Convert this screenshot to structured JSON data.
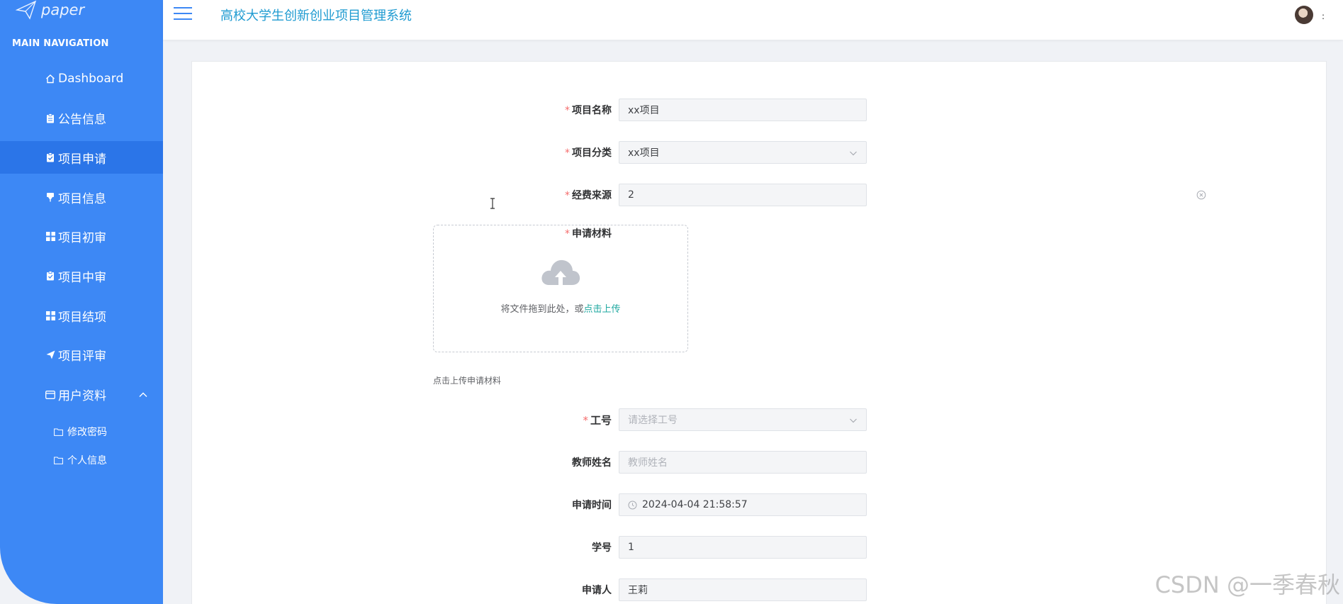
{
  "brand": {
    "name": "paper"
  },
  "sidebar": {
    "section_title": "MAIN NAVIGATION",
    "items": [
      {
        "label": "Dashboard",
        "icon": "home-icon"
      },
      {
        "label": "公告信息",
        "icon": "clipboard-icon"
      },
      {
        "label": "项目申请",
        "icon": "clipboard-check-icon",
        "active": true
      },
      {
        "label": "项目信息",
        "icon": "pin-icon"
      },
      {
        "label": "项目初审",
        "icon": "grid-icon"
      },
      {
        "label": "项目中审",
        "icon": "clipboard-check-icon"
      },
      {
        "label": "项目结项",
        "icon": "grid-icon"
      },
      {
        "label": "项目评审",
        "icon": "send-icon"
      },
      {
        "label": "用户资料",
        "icon": "card-icon",
        "expanded": true
      }
    ],
    "sub_items": [
      {
        "label": "修改密码",
        "icon": "folder-icon"
      },
      {
        "label": "个人信息",
        "icon": "folder-icon"
      }
    ]
  },
  "header": {
    "title": "高校大学生创新创业项目管理系统",
    "avatar_menu": ":"
  },
  "form": {
    "project_name": {
      "label": "项目名称",
      "value": "xx项目"
    },
    "project_category": {
      "label": "项目分类",
      "value": "xx项目"
    },
    "funding_source": {
      "label": "经费来源",
      "value": "2"
    },
    "materials": {
      "label": "申请材料",
      "drop_text": "将文件拖到此处，或",
      "click_text": "点击上传",
      "tip": "点击上传申请材料"
    },
    "staff_no": {
      "label": "工号",
      "placeholder": "请选择工号"
    },
    "teacher_name": {
      "label": "教师姓名",
      "placeholder": "教师姓名"
    },
    "apply_time": {
      "label": "申请时间",
      "value": "2024-04-04 21:58:57"
    },
    "student_no": {
      "label": "学号",
      "value": "1"
    },
    "applicant": {
      "label": "申请人",
      "value": "王莉"
    }
  },
  "watermark": "CSDN @一季春秋",
  "colors": {
    "sidebar": "#3d88f5",
    "active": "#2b75e8",
    "title": "#1f9bd1",
    "required": "#f56c6c",
    "link": "#1fa8a0"
  }
}
